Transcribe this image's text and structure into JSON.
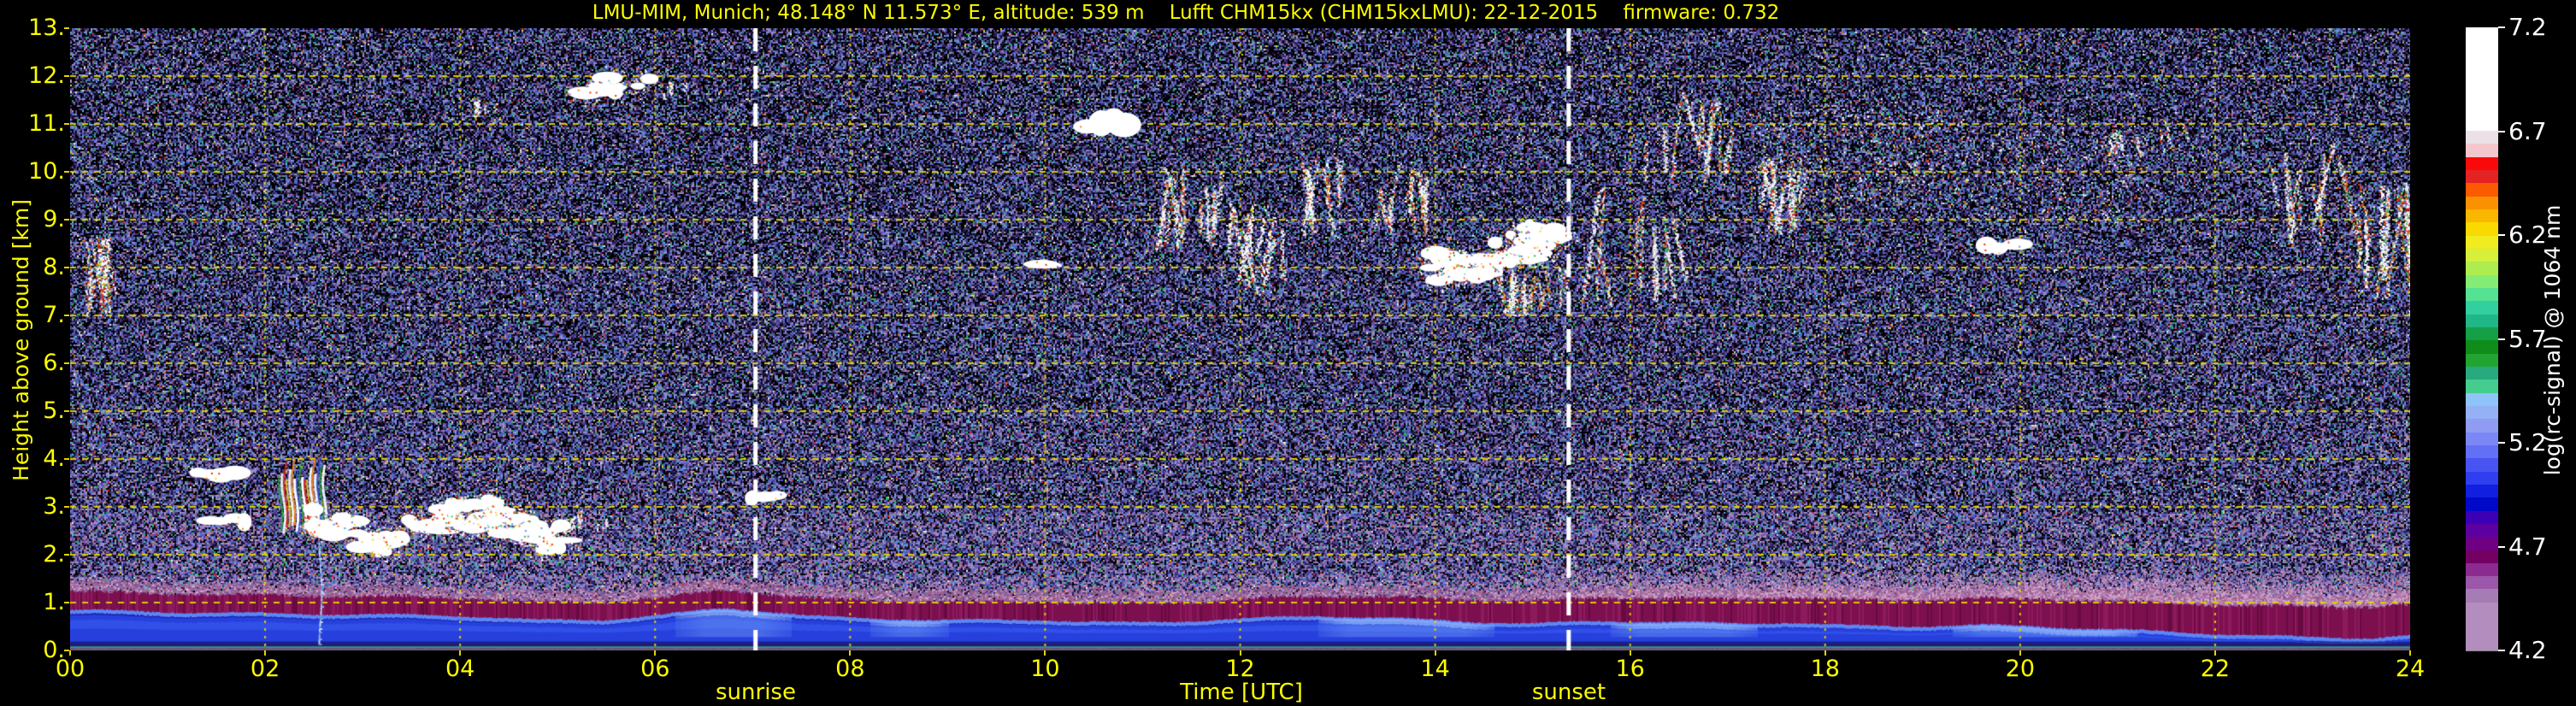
{
  "chart_data": {
    "type": "heatmap",
    "title": "LMU-MIM, Munich; 48.148° N 11.573° E, altitude: 539 m    Lufft CHM15kx (CHM15kxLMU): 22-12-2015    firmware: 0.732",
    "xlabel": "Time [UTC]",
    "ylabel": "Height above ground [km]",
    "colorbar_label": "log(rc-signal) @ 1064 nm",
    "x_range_hours": [
      0,
      24
    ],
    "y_range_km": [
      0,
      13
    ],
    "x_ticks": [
      "00",
      "02",
      "04",
      "06",
      "08",
      "10",
      "12",
      "14",
      "16",
      "18",
      "20",
      "22",
      "24"
    ],
    "y_ticks": [
      "13.",
      "12.",
      "11.",
      "10.",
      "9.",
      "8.",
      "7.",
      "6.",
      "5.",
      "4.",
      "3.",
      "2.",
      "1.",
      "0."
    ],
    "grid": {
      "x_step_hours": 2,
      "y_step_km": 1,
      "style": "yellow-dashed"
    },
    "colorbar_ticks": [
      "7.2",
      "6.7",
      "6.2",
      "5.7",
      "5.2",
      "4.7",
      "4.2"
    ],
    "colorbar_range": [
      4.2,
      7.2
    ],
    "annotations": [
      {
        "label": "sunrise",
        "hour": 7.03
      },
      {
        "label": "sunset",
        "hour": 15.37
      }
    ],
    "colors": {
      "axis_text": "#fcfc00",
      "grid": "#e4d200",
      "colorbar_text": "#ffffff",
      "sun_line": "#ffffff",
      "background": "#000000"
    },
    "colorbar_colors": [
      "#ffffff",
      "#ebe1e7",
      "#f3c7cd",
      "#f90909",
      "#e42323",
      "#fa5a00",
      "#fa9100",
      "#fab700",
      "#fad900",
      "#f1ec1f",
      "#d5ef3a",
      "#aeec50",
      "#83ec74",
      "#55e293",
      "#32cf9f",
      "#1fb787",
      "#14a046",
      "#0f8c1a",
      "#22a432",
      "#28a97e",
      "#45cd8e",
      "#8fc4f8",
      "#93b1f4",
      "#8f9cf2",
      "#7b87f4",
      "#6170f4",
      "#4854f2",
      "#2f3eee",
      "#101fe0",
      "#0208c8",
      "#3b00b5",
      "#5c00a2",
      "#6f0083",
      "#730062",
      "#8b2b8f",
      "#9b57a9",
      "#a67cb4",
      "#b28dbd"
    ],
    "noise_palette": {
      "base": [
        [
          "#241b47",
          0.155
        ],
        [
          "#463477",
          0.125
        ],
        [
          "#5b55a6",
          0.1
        ],
        [
          "#4d66cf",
          0.095
        ],
        [
          "#7d92df",
          0.055
        ],
        [
          "#8a86c8",
          0.04
        ],
        [
          "#2f9e8a",
          0.03
        ],
        [
          "#35b457",
          0.012
        ],
        [
          "#49c2d6",
          0.007
        ],
        [
          "#c9cda0",
          0.006
        ],
        [
          "#e0d23c",
          0.005
        ],
        [
          "#d06030",
          0.005
        ],
        [
          "#cc2828",
          0.004
        ],
        [
          "#e8e8ee",
          0.004
        ]
      ],
      "pink": [
        "#9b6fa5",
        "#b78ab8"
      ],
      "pink_steps": [
        [
          1.6,
          0.3
        ],
        [
          2.9,
          0.2
        ],
        [
          5.0,
          0.105
        ],
        [
          9.0,
          0.06
        ],
        [
          13.1,
          0.05
        ]
      ]
    },
    "boundary_layer": {
      "top_km_profile": [
        [
          0,
          0.78
        ],
        [
          1,
          0.76
        ],
        [
          2,
          0.74
        ],
        [
          3,
          0.7
        ],
        [
          4,
          0.66
        ],
        [
          4.8,
          0.58
        ],
        [
          5.5,
          0.6
        ],
        [
          6.3,
          0.76
        ],
        [
          6.7,
          0.84
        ],
        [
          7.1,
          0.78
        ],
        [
          7.6,
          0.66
        ],
        [
          8,
          0.61
        ],
        [
          9,
          0.58
        ],
        [
          10,
          0.6
        ],
        [
          10.8,
          0.54
        ],
        [
          11.5,
          0.56
        ],
        [
          12,
          0.6
        ],
        [
          12.8,
          0.66
        ],
        [
          13.5,
          0.63
        ],
        [
          14.2,
          0.58
        ],
        [
          15,
          0.52
        ],
        [
          15.6,
          0.56
        ],
        [
          16.2,
          0.54
        ],
        [
          17,
          0.5
        ],
        [
          17.6,
          0.53
        ],
        [
          18.2,
          0.48
        ],
        [
          19,
          0.47
        ],
        [
          19.6,
          0.49
        ],
        [
          20.2,
          0.44
        ],
        [
          21,
          0.37
        ],
        [
          22,
          0.3
        ],
        [
          23,
          0.24
        ],
        [
          23.6,
          0.22
        ],
        [
          24,
          0.27
        ]
      ],
      "mixing_top_extra_km": [
        [
          0,
          0.45
        ],
        [
          6,
          0.42
        ],
        [
          12,
          0.46
        ],
        [
          16,
          0.55
        ],
        [
          20,
          0.62
        ],
        [
          24,
          0.72
        ]
      ],
      "bright_patches_hours": [
        [
          6.2,
          7.4
        ],
        [
          8.2,
          9.0
        ],
        [
          12.8,
          14.6
        ],
        [
          15.8,
          17.3
        ],
        [
          19.3,
          21.2
        ]
      ],
      "layer_colors": {
        "blue_deep": "#1b27b2",
        "blue_mid": "#2740dd",
        "blue_up": "#3050e8",
        "crest": "#5d86f4",
        "magenta": "#7c104e",
        "magenta_lt": "#8e1a5e",
        "magenta_dk": "#670a40",
        "haze": [
          "#c490bc",
          "#b077a8",
          "#d7a9cd",
          "#9a5f92"
        ],
        "strip_indigo": "#231a6e",
        "strip_teal": "#2d9a8c",
        "strip_gray": "#6a5878"
      }
    },
    "precip_streak": {
      "hour": 2.56,
      "h_km": [
        0.12,
        2.25
      ]
    },
    "cloud_palette": [
      [
        "#ffffff",
        0.45
      ],
      [
        "#e83010",
        0.16
      ],
      [
        "#f08020",
        0.11
      ],
      [
        "#f0d838",
        0.08
      ],
      [
        "#34b854",
        0.08
      ],
      [
        "#3fb4d8",
        0.06
      ],
      [
        "#6b85ea",
        0.06
      ]
    ],
    "rainbow_pattern": [
      "#2ca040",
      "#ffffff",
      "#d82418",
      "#f0d030",
      "#ffffff",
      "#ff8c1e",
      "#ffffff",
      "#3c58d0"
    ],
    "clouds": [
      {
        "id": "midnight-left",
        "t": [
          0.0,
          0.42
        ],
        "h": [
          6.8,
          8.7
        ],
        "kind": "streaks",
        "density": 2.2
      },
      {
        "id": "white-dash-1",
        "t": [
          1.25,
          1.75
        ],
        "h": [
          3.55,
          3.82
        ],
        "kind": "white",
        "density": 1.0
      },
      {
        "id": "white-dash-2",
        "t": [
          1.35,
          1.85
        ],
        "h": [
          2.55,
          2.92
        ],
        "kind": "white",
        "density": 0.8
      },
      {
        "id": "rainbow-streaks",
        "t": [
          2.15,
          2.62
        ],
        "h": [
          2.4,
          4.05
        ],
        "kind": "rainbow",
        "density": 1.6
      },
      {
        "id": "stratocu-main",
        "t": [
          2.45,
          5.1
        ],
        "h": [
          1.95,
          3.35
        ],
        "kind": "whitefringe",
        "density": 1.8
      },
      {
        "id": "small-morning",
        "t": [
          5.05,
          5.5
        ],
        "h": [
          2.45,
          2.95
        ],
        "kind": "streaks",
        "density": 1.2
      },
      {
        "id": "high-bit",
        "t": [
          4.05,
          4.45
        ],
        "h": [
          11.0,
          11.5
        ],
        "kind": "streaks",
        "density": 0.9
      },
      {
        "id": "cirrus-dawn",
        "t": [
          5.2,
          5.95
        ],
        "h": [
          11.25,
          12.3
        ],
        "kind": "whitefringe",
        "density": 0.8
      },
      {
        "id": "cirrus-dawn2",
        "t": [
          5.9,
          6.3
        ],
        "h": [
          11.5,
          11.95
        ],
        "kind": "streaks",
        "density": 0.9
      },
      {
        "id": "sunrise-dash",
        "t": [
          6.95,
          7.3
        ],
        "h": [
          3.08,
          3.34
        ],
        "kind": "white",
        "density": 0.7
      },
      {
        "id": "midday-dot",
        "t": [
          9.9,
          10.12
        ],
        "h": [
          7.9,
          8.2
        ],
        "kind": "white",
        "density": 0.5
      },
      {
        "id": "high-thin",
        "t": [
          10.35,
          10.9
        ],
        "h": [
          10.75,
          11.3
        ],
        "kind": "white",
        "density": 0.5
      },
      {
        "id": "noon-streaks-1",
        "t": [
          11.15,
          11.85
        ],
        "h": [
          8.3,
          10.2
        ],
        "kind": "streaks",
        "density": 1.4
      },
      {
        "id": "noon-streaks-2",
        "t": [
          11.9,
          12.5
        ],
        "h": [
          7.4,
          9.4
        ],
        "kind": "streaks",
        "density": 1.4
      },
      {
        "id": "noon-streaks-3",
        "t": [
          12.55,
          13.15
        ],
        "h": [
          8.6,
          10.4
        ],
        "kind": "streaks",
        "density": 1.3
      },
      {
        "id": "aft-streaks",
        "t": [
          13.35,
          13.98
        ],
        "h": [
          8.7,
          10.1
        ],
        "kind": "streaks",
        "density": 1.5
      },
      {
        "id": "aft-bright",
        "t": [
          13.95,
          15.3
        ],
        "h": [
          7.5,
          9.15
        ],
        "kind": "whitefringe",
        "density": 2.2
      },
      {
        "id": "aft-columns",
        "t": [
          14.4,
          15.35
        ],
        "h": [
          6.9,
          8.0
        ],
        "kind": "streaks",
        "density": 1.6
      },
      {
        "id": "dusk-streaks",
        "t": [
          15.5,
          16.5
        ],
        "h": [
          6.9,
          9.7
        ],
        "kind": "streaks",
        "density": 0.9
      },
      {
        "id": "dusk-high",
        "t": [
          16.1,
          17.2
        ],
        "h": [
          9.7,
          11.7
        ],
        "kind": "streaks",
        "density": 0.9
      },
      {
        "id": "cirrus-field",
        "t": [
          17.2,
          19.45
        ],
        "h": [
          9.3,
          11.3
        ],
        "kind": "speckle",
        "density": 1.6
      },
      {
        "id": "cirrus-streak",
        "t": [
          17.3,
          17.8
        ],
        "h": [
          8.4,
          10.4
        ],
        "kind": "streaks",
        "density": 1.5
      },
      {
        "id": "eve-speckle",
        "t": [
          19.45,
          21.3
        ],
        "h": [
          8.9,
          10.9
        ],
        "kind": "speckle",
        "density": 1.0
      },
      {
        "id": "eve-blob",
        "t": [
          19.6,
          20.05
        ],
        "h": [
          8.25,
          8.62
        ],
        "kind": "white",
        "density": 0.9
      },
      {
        "id": "late-streaks",
        "t": [
          20.9,
          21.8
        ],
        "h": [
          10.3,
          11.1
        ],
        "kind": "streaks",
        "density": 0.7
      },
      {
        "id": "night-streaks-1",
        "t": [
          22.55,
          23.35
        ],
        "h": [
          8.2,
          10.6
        ],
        "kind": "streaks",
        "density": 1.2
      },
      {
        "id": "night-streaks-2",
        "t": [
          23.3,
          24.0
        ],
        "h": [
          6.9,
          9.8
        ],
        "kind": "streaks",
        "density": 1.6
      }
    ]
  }
}
